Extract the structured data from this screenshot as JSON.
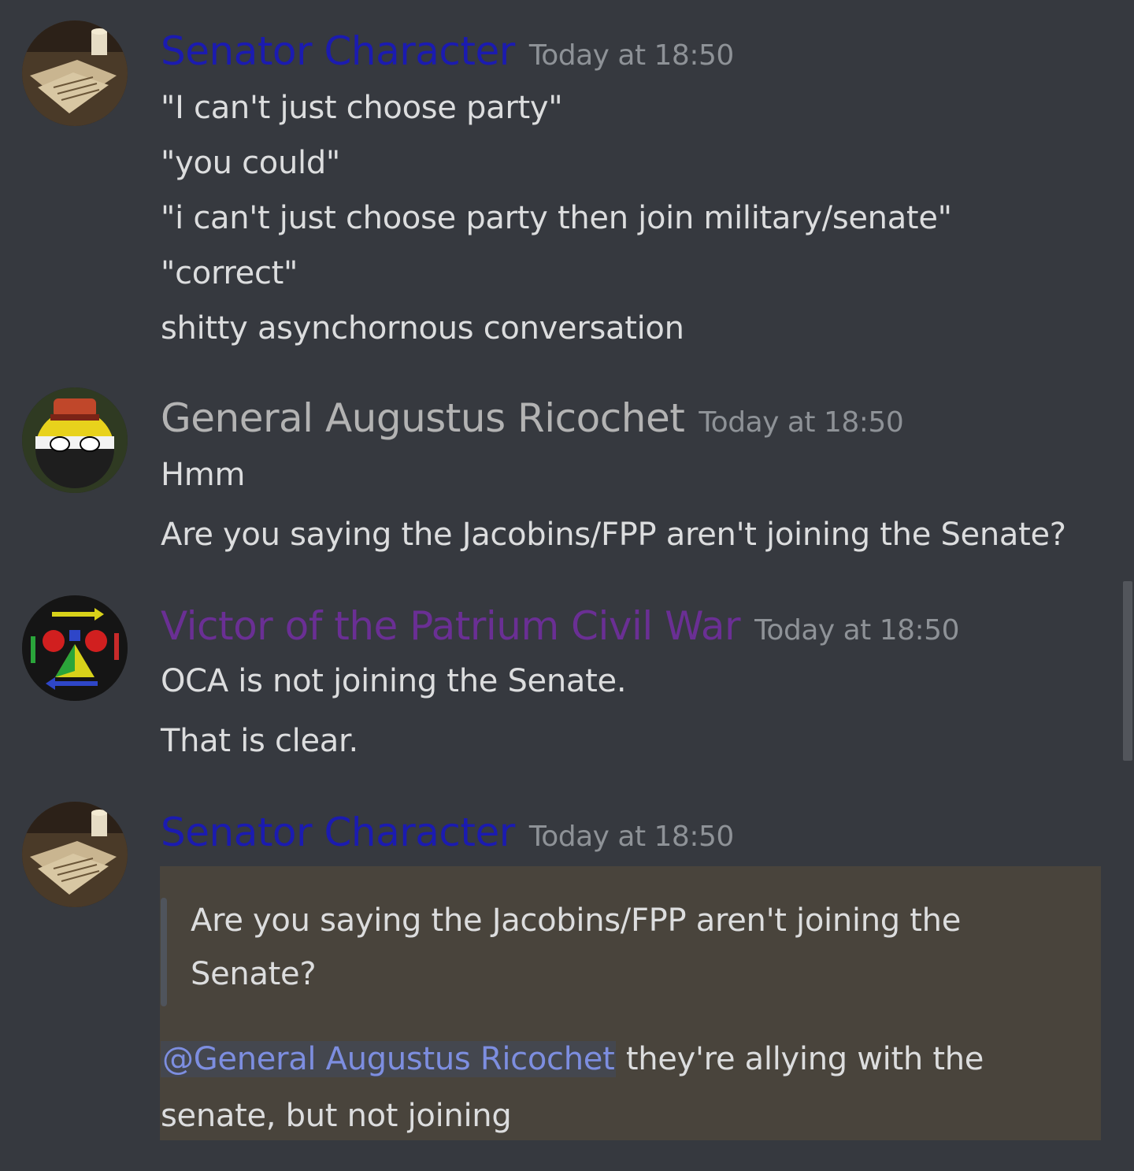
{
  "messages": [
    {
      "author": "Senator Character",
      "author_color": "#1b1bb0",
      "timestamp": "Today at 18:50",
      "avatar_icon": "paper-writing-icon",
      "lines": [
        "\"I can't just choose party\"",
        "\"you could\"",
        "\"i can't just choose party then join military/senate\"",
        "\"correct\"",
        "shitty asynchornous conversation"
      ]
    },
    {
      "author": "General Augustus Ricochet",
      "author_color": "#b3b3b3",
      "timestamp": "Today at 18:50",
      "avatar_icon": "countryball-general-icon",
      "lines": [
        "Hmm",
        "Are you saying the Jacobins/FPP aren't joining the Senate?"
      ]
    },
    {
      "author": "Victor of the Patrium Civil War",
      "author_color": "#6a2f94",
      "timestamp": "Today at 18:50",
      "avatar_icon": "faction-arrows-icon",
      "lines": [
        "OCA is not joining the Senate.",
        "That is clear."
      ]
    },
    {
      "author": "Senator Character",
      "author_color": "#1b1bb0",
      "timestamp": "Today at 18:50",
      "avatar_icon": "paper-writing-icon",
      "quote_lines": [
        "Are you saying the Jacobins/FPP aren't joining the",
        "Senate?"
      ],
      "mention": "@General Augustus Ricochet",
      "reply_line_1": " they're allying with the",
      "reply_line_2": "senate, but not joining"
    }
  ]
}
